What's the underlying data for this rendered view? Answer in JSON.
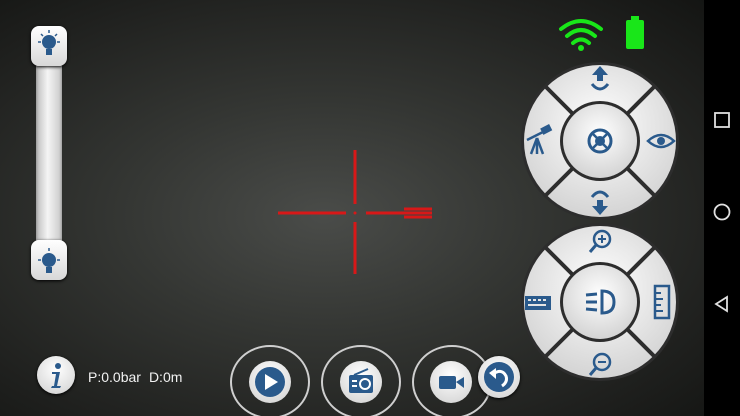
{
  "status": {
    "pressure": "P:0.0bar",
    "depth": "D:0m"
  },
  "indicators": {
    "wifi_icon": "wifi-icon",
    "battery_icon": "battery-icon",
    "indicator_color": "#19e619"
  },
  "crosshair": {
    "color": "#d81818"
  },
  "light_slider": {
    "top_icon": "bulb-bright-icon",
    "bottom_icon": "bulb-dim-icon"
  },
  "direction_pad": {
    "up": "arrow-up-icon",
    "down": "arrow-down-icon",
    "left": "telescope-icon",
    "right": "eye-icon",
    "center": "focus-target-icon"
  },
  "control_pad": {
    "up": "zoom-in-icon",
    "down": "zoom-out-icon",
    "left": "keyboard-icon",
    "right": "ruler-icon",
    "center": "headlight-icon"
  },
  "bottom_bar": {
    "info": "info-icon",
    "play": "play-icon",
    "radio": "radio-icon",
    "video": "video-camera-icon",
    "back": "undo-icon"
  },
  "android_nav": {
    "recent": "square-icon",
    "home": "circle-icon",
    "back": "triangle-back-icon"
  },
  "colors": {
    "accent": "#2a5a8c",
    "button_face": "#ececec"
  }
}
